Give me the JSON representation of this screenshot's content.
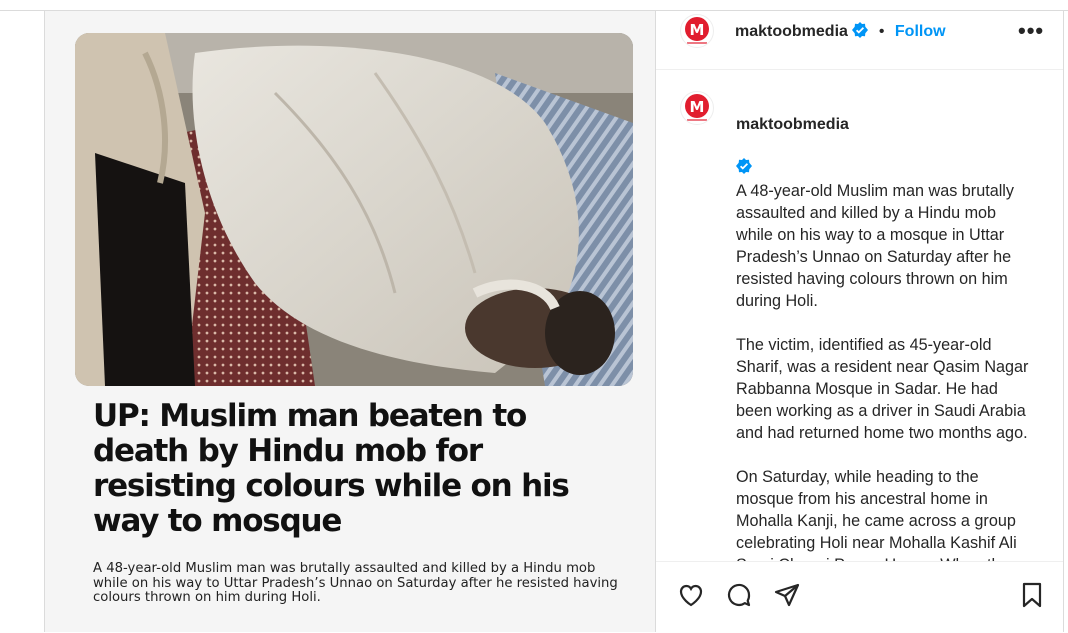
{
  "account": {
    "username": "maktoobmedia",
    "follow_label": "Follow",
    "separator": "•",
    "more_label": "•••",
    "avatar_letter": "M",
    "brand_color": "#e11d2e"
  },
  "post_image": {
    "headline": "UP: Muslim man beaten to death by Hindu mob for resisting colours while on his way to mosque",
    "summary": "A 48-year-old Muslim man was brutally assaulted and killed by a Hindu mob while on his way to Uttar Pradesh’s Unnao on Saturday after he resisted having colours thrown on him during Holi."
  },
  "caption": {
    "lead": "A 48-year-old Muslim man was brutally assaulted and killed by a Hindu mob while on his way to a mosque in Uttar Pradesh’s Unnao on Saturday after he resisted having colours thrown on him during Holi.",
    "paragraph_2": "The victim, identified as 45-year-old Sharif, was a resident near Qasim Nagar Rabbanna Mosque in Sadar. He had been working as a driver in Saudi Arabia and had returned home two months ago.",
    "paragraph_3": "On Saturday, while heading to the mosque from his ancestral home in Mohalla Kanji, he came across a group celebrating Holi near Mohalla Kashif Ali Sarai Chungi Power House. When the group threw colours on him, he objected. However, they repeated the act"
  },
  "actions": {
    "icons": [
      "heart-icon",
      "comment-icon",
      "share-icon",
      "bookmark-icon"
    ]
  }
}
